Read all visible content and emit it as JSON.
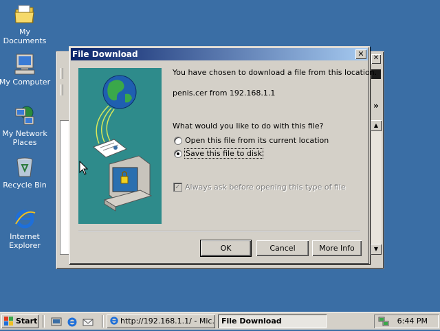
{
  "desktop": {
    "icons": [
      {
        "label": "My Documents",
        "icon": "folder-icon"
      },
      {
        "label": "My Computer",
        "icon": "computer-icon"
      },
      {
        "label": "My Network Places",
        "icon": "network-icon"
      },
      {
        "label": "Recycle Bin",
        "icon": "recycle-bin-icon"
      },
      {
        "label": "Internet Explorer",
        "icon": "ie-icon"
      }
    ]
  },
  "dialog": {
    "title": "File Download",
    "intro": "You have chosen to download a file from this location.",
    "file_info": "penis.cer from 192.168.1.1",
    "question": "What would you like to do with this file?",
    "option_open": "Open this file from its current location",
    "option_save": "Save this file to disk",
    "selected_option": "save",
    "always_ask": "Always ask before opening this type of file",
    "always_ask_checked": true,
    "ok_label": "OK",
    "cancel_label": "Cancel",
    "more_info_label": "More Info",
    "close_glyph": "✕"
  },
  "taskbar": {
    "start_label": "Start",
    "tasks": [
      {
        "label": "http://192.168.1.1/ - Mic...",
        "active": false
      },
      {
        "label": "File Download",
        "active": true
      }
    ],
    "clock": "6:44 PM"
  },
  "background_window": {
    "toolbar_overflow": "»"
  },
  "colors": {
    "desktop": "#3a6ea5",
    "title_start": "#0a246a",
    "title_end": "#a6caf0",
    "face": "#d4d0c8",
    "illustration": "#2e8b8b"
  }
}
